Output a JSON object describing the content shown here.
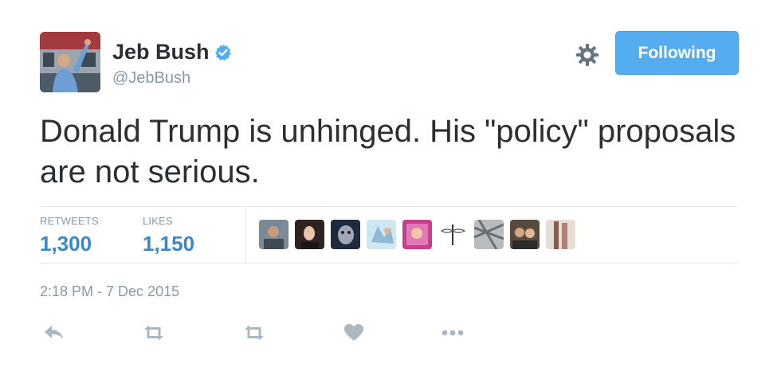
{
  "author": {
    "name": "Jeb Bush",
    "handle": "@JebBush",
    "avatar_icon": "profile-photo"
  },
  "follow_button": {
    "label": "Following",
    "color": "#55acee"
  },
  "settings_icon": "gear-icon",
  "tweet": {
    "text": "Donald Trump is unhinged. His \"policy\" proposals are not serious."
  },
  "stats": {
    "retweets_label": "RETWEETS",
    "retweets_value": "1,300",
    "likes_label": "LIKES",
    "likes_value": "1,150"
  },
  "likers_count_shown": 9,
  "timestamp": "2:18 PM - 7 Dec 2015",
  "actions": [
    "reply-icon",
    "retweet-icon",
    "retweet-icon",
    "like-icon",
    "more-icon"
  ],
  "colors": {
    "link": "#3b88c3",
    "muted": "#8899a6",
    "text": "#292f33",
    "action_icon": "#aab8c2"
  }
}
